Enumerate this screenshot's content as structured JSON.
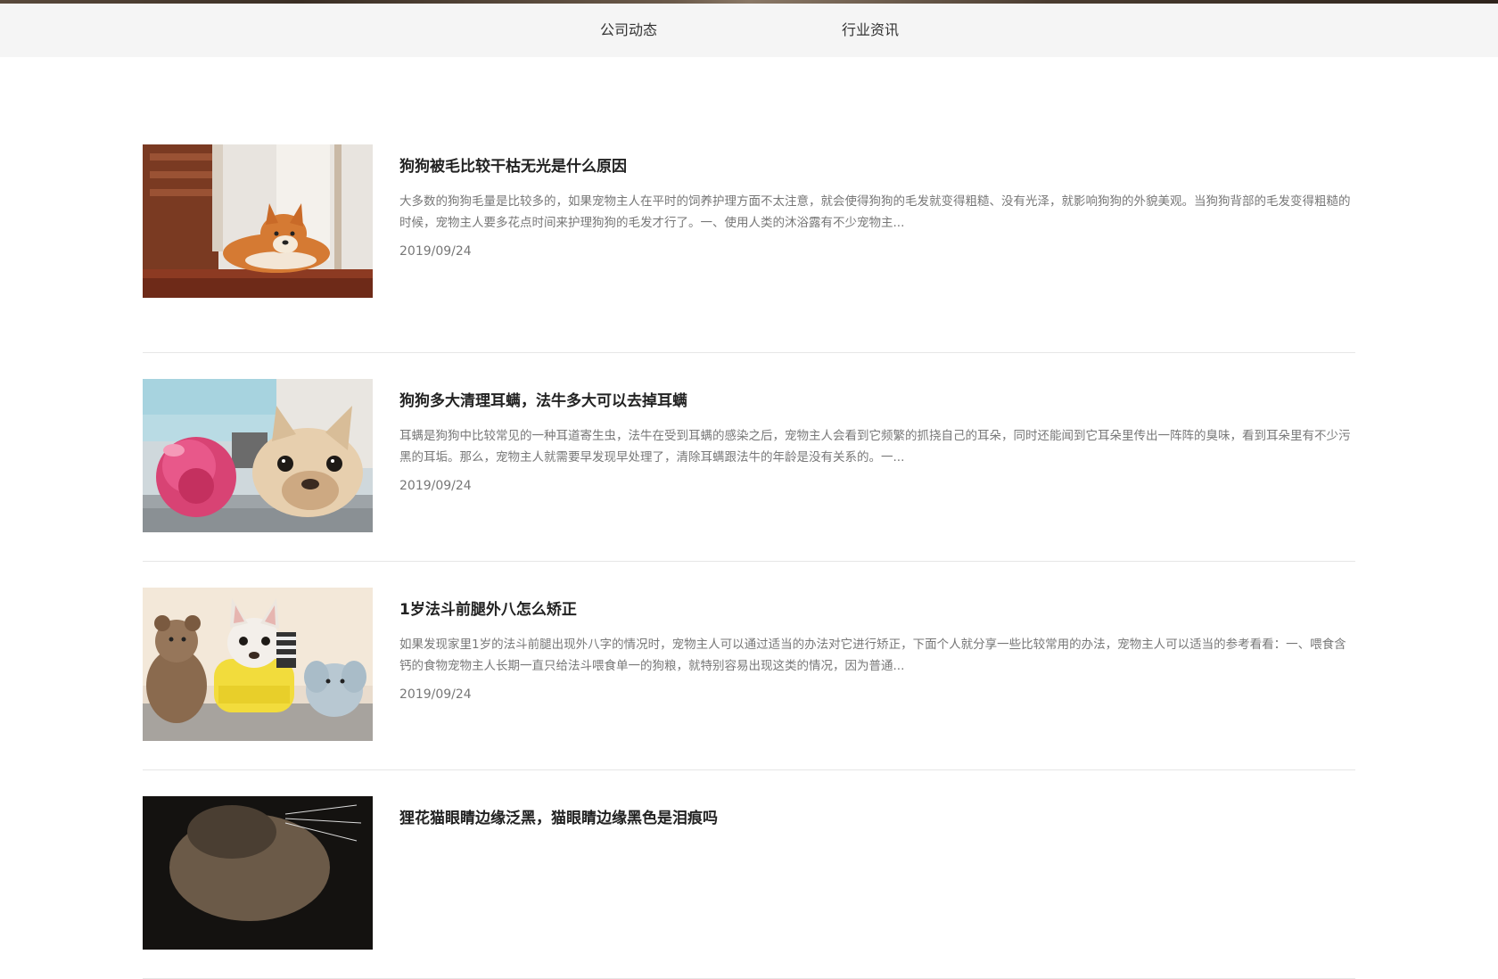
{
  "tabs": [
    {
      "label": "公司动态"
    },
    {
      "label": "行业资讯"
    }
  ],
  "articles": [
    {
      "title": "狗狗被毛比较干枯无光是什么原因",
      "desc": "大多数的狗狗毛量是比较多的，如果宠物主人在平时的饲养护理方面不太注意，就会使得狗狗的毛发就变得粗糙、没有光泽，就影响狗狗的外貌美观。当狗狗背部的毛发变得粗糙的时候，宠物主人要多花点时间来护理狗狗的毛发才行了。一、使用人类的沐浴露有不少宠物主...",
      "date": "2019/09/24"
    },
    {
      "title": "狗狗多大清理耳螨，法牛多大可以去掉耳螨",
      "desc": "耳螨是狗狗中比较常见的一种耳道寄生虫，法牛在受到耳螨的感染之后，宠物主人会看到它频繁的抓挠自己的耳朵，同时还能闻到它耳朵里传出一阵阵的臭味，看到耳朵里有不少污黑的耳垢。那么，宠物主人就需要早发现早处理了，清除耳螨跟法牛的年龄是没有关系的。一...",
      "date": "2019/09/24"
    },
    {
      "title": "1岁法斗前腿外八怎么矫正",
      "desc": "如果发现家里1岁的法斗前腿出现外八字的情况时，宠物主人可以通过适当的办法对它进行矫正，下面个人就分享一些比较常用的办法，宠物主人可以适当的参考看看：一、喂食含钙的食物宠物主人长期一直只给法斗喂食单一的狗粮，就特别容易出现这类的情况，因为普通...",
      "date": "2019/09/24"
    },
    {
      "title": "狸花猫眼睛边缘泛黑，猫眼睛边缘黑色是泪痕吗",
      "desc": "",
      "date": ""
    }
  ]
}
